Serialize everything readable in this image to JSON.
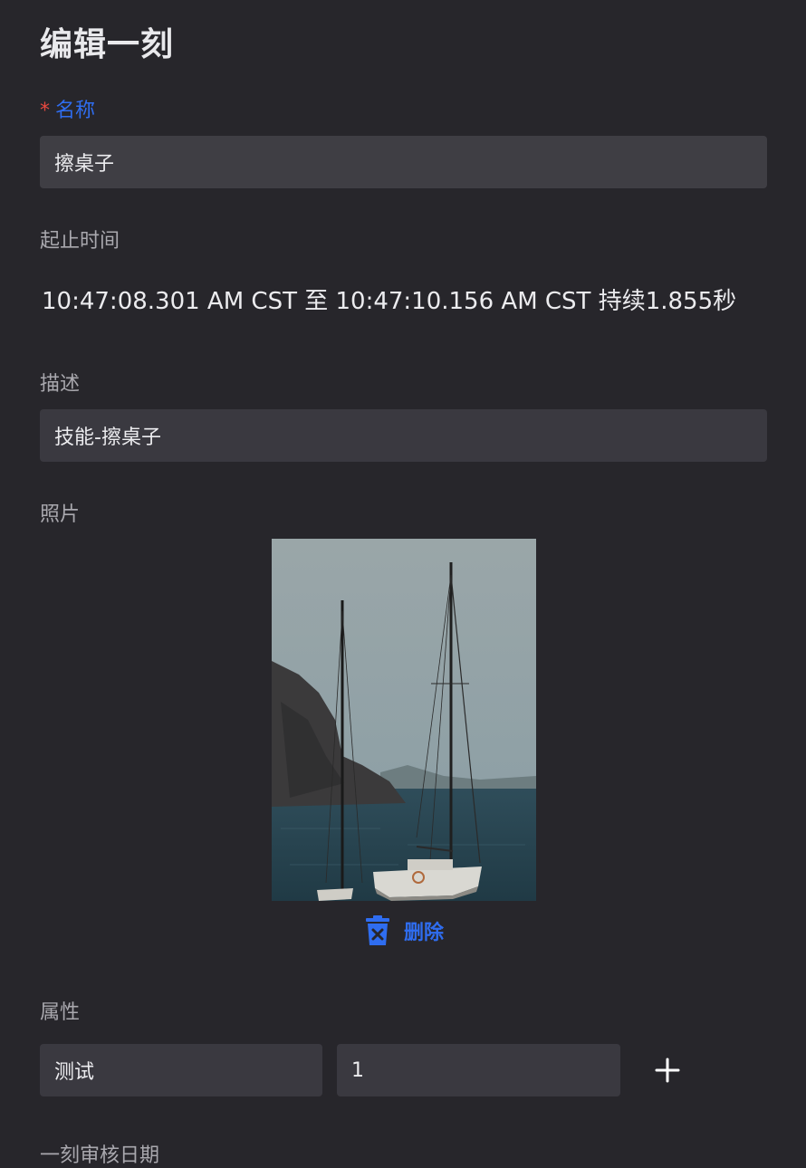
{
  "page": {
    "title": "编辑一刻"
  },
  "name_field": {
    "required_mark": "*",
    "label": "名称",
    "value": "擦桌子"
  },
  "time_field": {
    "label": "起止时间",
    "value": "10:47:08.301 AM CST 至 10:47:10.156 AM CST 持续1.855秒"
  },
  "description_field": {
    "label": "描述",
    "value": "技能-擦桌子"
  },
  "photo_field": {
    "label": "照片",
    "photo_icon": "sailboat-photo",
    "delete_label": "删除",
    "delete_icon": "trash-icon"
  },
  "attributes_field": {
    "label": "属性",
    "rows": [
      {
        "key": "测试",
        "value": "1"
      }
    ],
    "add_icon": "plus-icon"
  },
  "review_date_field": {
    "label": "一刻审核日期"
  },
  "colors": {
    "background": "#27262b",
    "input_bg": "#3f3e44",
    "accent": "#2f6df0",
    "required": "#e8483f",
    "label": "#a9a8ae"
  }
}
